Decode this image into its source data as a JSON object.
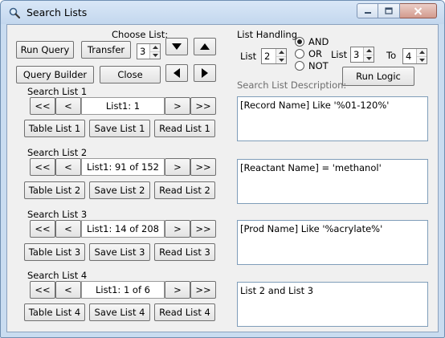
{
  "window": {
    "title": "Search Lists",
    "icons": {
      "app": "magnifier-icon",
      "minimize": "minimize-icon",
      "maximize": "maximize-icon",
      "close": "close-icon"
    }
  },
  "top": {
    "run_query": "Run Query",
    "transfer": "Transfer",
    "choose_list_label": "Choose List:",
    "choose_list_value": "3",
    "query_builder": "Query Builder",
    "close": "Close",
    "arrow_icons": [
      "triangle-down-icon",
      "triangle-up-icon",
      "triangle-left-icon",
      "triangle-right-icon"
    ]
  },
  "list_handling": {
    "label": "List Handling",
    "list_label": "List",
    "list_value": "2",
    "operators": [
      {
        "label": "AND",
        "checked": true
      },
      {
        "label": "OR",
        "checked": false
      },
      {
        "label": "NOT",
        "checked": false
      }
    ],
    "list2_label": "List",
    "list2_value": "3",
    "to_label": "To",
    "to_value": "4",
    "run_logic": "Run Logic",
    "description_label": "Search List Description:"
  },
  "nav_labels": {
    "first": "<<",
    "prev": "<",
    "next": ">",
    "last": ">>"
  },
  "lists": [
    {
      "title": "Search List 1",
      "position": "List1: 1",
      "table": "Table List 1",
      "save": "Save List 1",
      "read": "Read List 1",
      "description": "[Record Name] Like '%01-120%'"
    },
    {
      "title": "Search List 2",
      "position": "List1: 91 of 152",
      "table": "Table List 2",
      "save": "Save List 2",
      "read": "Read List 2",
      "description": "[Reactant Name] = 'methanol'"
    },
    {
      "title": "Search List 3",
      "position": "List1: 14 of 208",
      "table": "Table List 3",
      "save": "Save List 3",
      "read": "Read List 3",
      "description": "[Prod Name] Like '%acrylate%'"
    },
    {
      "title": "Search List 4",
      "position": "List1: 1 of 6",
      "table": "Table List 4",
      "save": "Save List 4",
      "read": "Read List 4",
      "description": "List 2 and List 3"
    }
  ]
}
